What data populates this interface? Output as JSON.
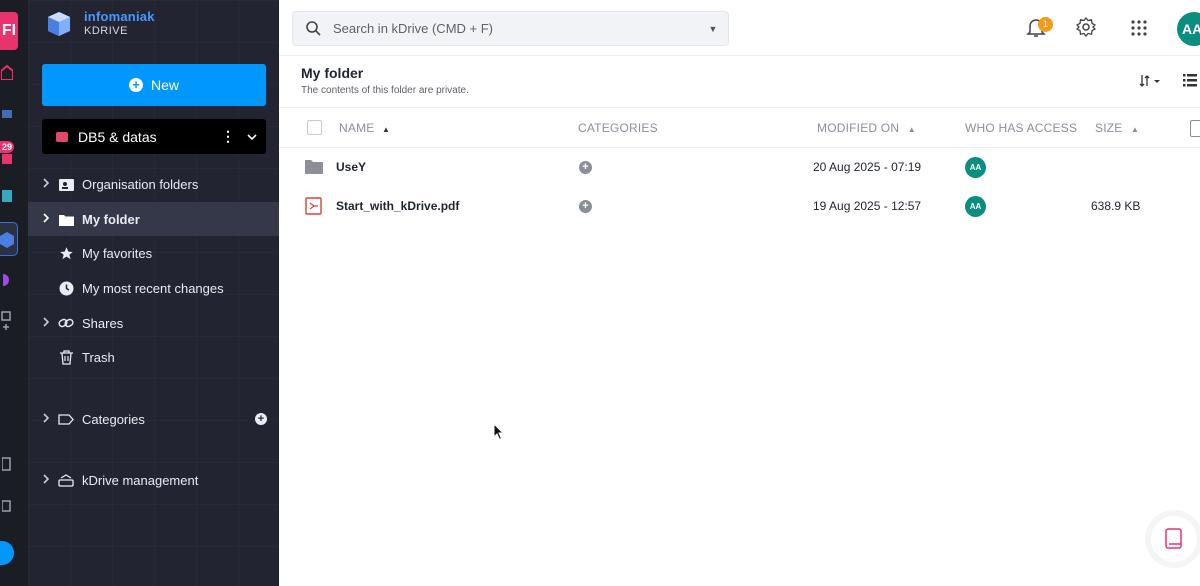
{
  "rail": {
    "logo_text": "FI",
    "badge_count": "29"
  },
  "brand": {
    "name": "infomaniak",
    "product": "KDRIVE"
  },
  "sidebar": {
    "new_label": "New",
    "drive_name": "DB5 & datas",
    "items": [
      {
        "label": "Organisation folders",
        "icon": "org-folder-icon"
      },
      {
        "label": "My folder",
        "icon": "folder-icon"
      },
      {
        "label": "My favorites",
        "icon": "star-icon"
      },
      {
        "label": "My most recent changes",
        "icon": "clock-icon"
      },
      {
        "label": "Shares",
        "icon": "link-icon"
      },
      {
        "label": "Trash",
        "icon": "trash-icon"
      },
      {
        "label": "Categories",
        "icon": "tag-icon"
      },
      {
        "label": "kDrive management",
        "icon": "drive-management-icon"
      }
    ]
  },
  "topbar": {
    "search_placeholder": "Search in kDrive (CMD + F)",
    "notification_count": "1",
    "avatar_initials": "AA"
  },
  "folder": {
    "title": "My folder",
    "subtitle": "The contents of this folder are private."
  },
  "table": {
    "headers": {
      "name": "NAME",
      "categories": "CATEGORIES",
      "modified": "MODIFIED ON",
      "access": "WHO HAS ACCESS",
      "size": "SIZE"
    },
    "rows": [
      {
        "name": "UseY",
        "type": "folder",
        "modified": "20 Aug 2025 - 07:19",
        "access": "AA",
        "size": ""
      },
      {
        "name": "Start_with_kDrive.pdf",
        "type": "pdf",
        "modified": "19 Aug 2025 - 12:57",
        "access": "AA",
        "size": "638.9 KB"
      }
    ]
  },
  "colors": {
    "accent": "#0098ff",
    "sidebar_bg": "#222531",
    "avatar": "#0a8f7e",
    "badge": "#f39a1c",
    "pink": "#e8336d"
  }
}
